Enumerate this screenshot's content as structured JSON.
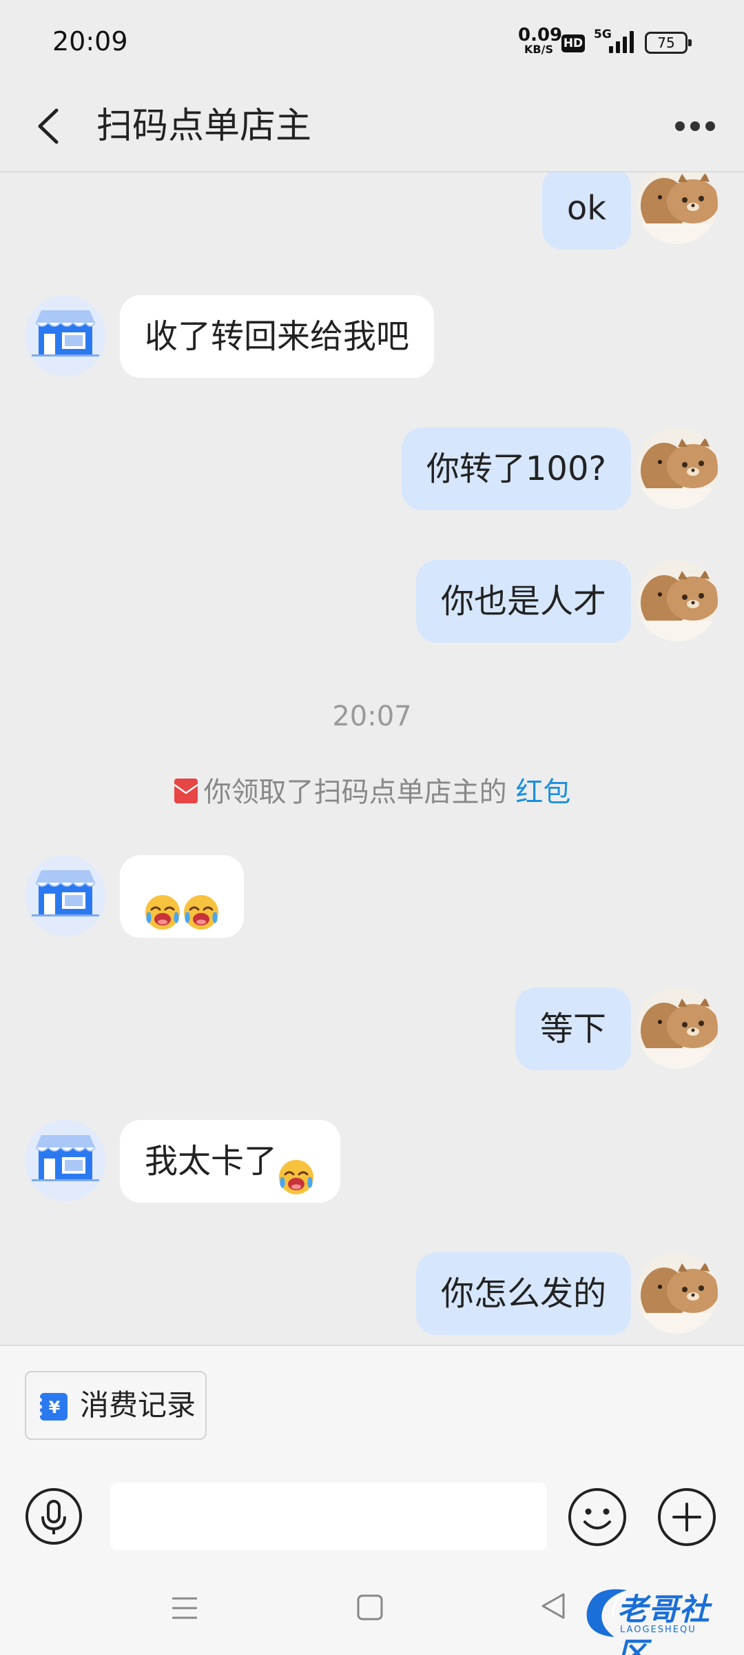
{
  "status_bar": {
    "time": "20:09",
    "net_speed_value": "0.09",
    "net_speed_unit": "KB/S",
    "hd_badge": "HD",
    "network_type": "5G",
    "battery_level": "75"
  },
  "header": {
    "title": "扫码点单店主"
  },
  "messages": [
    {
      "direction": "out",
      "text": "ok"
    },
    {
      "direction": "in",
      "text": "收了转回来给我吧"
    },
    {
      "direction": "out",
      "text": "你转了100?"
    },
    {
      "direction": "out",
      "text": "你也是人才"
    },
    {
      "direction": "out",
      "text": "等下"
    },
    {
      "direction": "in",
      "text": "我太卡了"
    },
    {
      "direction": "out",
      "text": "你怎么发的"
    }
  ],
  "timestamp": "20:07",
  "system_notice": {
    "text": "你领取了扫码点单店主的",
    "link_text": "红包"
  },
  "emoji_message": [
    "crying-laughing-emoji",
    "crying-laughing-emoji"
  ],
  "bottom": {
    "chip_label": "消费记录",
    "input_value": ""
  },
  "watermark": {
    "text": "老哥社区",
    "subtext": "LAOGESHEQU"
  },
  "colors": {
    "outgoing_bubble": "#d6e6fd",
    "incoming_bubble": "#ffffff",
    "background": "#ededed",
    "link": "#1a8fe0",
    "shop_icon": "#2b79f0"
  }
}
